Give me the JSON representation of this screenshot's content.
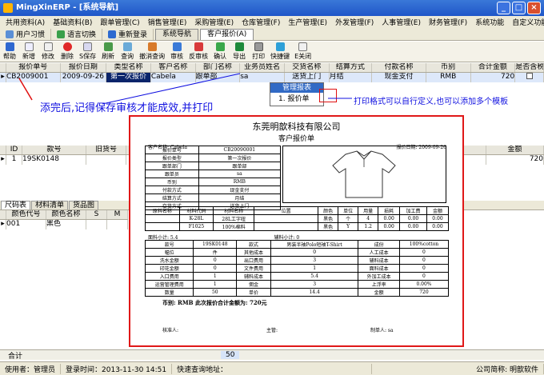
{
  "window": {
    "title": "MingXinERP - [系统导航]",
    "min": "_",
    "max": "□",
    "close": "×"
  },
  "menu": [
    "共用资料(A)",
    "基础资料(B)",
    "跟单管理(C)",
    "销售管理(E)",
    "采购管理(E)",
    "仓库管理(F)",
    "生产管理(E)",
    "外发管理(F)",
    "人事管理(E)",
    "财务管理(F)",
    "系统功能",
    "自定义功能"
  ],
  "quickbar": {
    "user_habits": "用户习惯",
    "language": "语言切换",
    "relogin": "重新登录",
    "tabs": [
      "系统导航",
      "客户报价(A)"
    ]
  },
  "toolbar": [
    "帮助",
    "新增",
    "修改",
    "删除",
    "S保存",
    "刷新",
    "查询",
    "撤消查询",
    "审核",
    "反审核",
    "确认",
    "导出",
    "打印",
    "快捷键",
    "E关闭"
  ],
  "grid": {
    "headers": [
      "报价单号",
      "报价日期",
      "类型名称",
      "客户名称",
      "部门名称",
      "业务员姓名",
      "交货名称",
      "结算方式",
      "付款名称",
      "币别",
      "合计金额",
      "是否含税"
    ],
    "row": [
      "CB2009001",
      "2009-09-26",
      "第一次报价",
      "Cabela",
      "跟单部",
      "sa",
      "送货上门",
      "月结",
      "现金支付",
      "RMB",
      "720",
      ""
    ]
  },
  "popup": {
    "header": "管理报表",
    "item": "1. 报价单"
  },
  "annotations": {
    "left": "添完后,记得保存审核才能成效,并打印",
    "right": "打印格式可以自行定义,也可以添加多个模板"
  },
  "detail_grid": {
    "headers": [
      "ID",
      "款号",
      "旧货号",
      "述",
      "金额"
    ],
    "row": [
      "1",
      "19SK0148",
      "",
      "",
      "720"
    ]
  },
  "bottom_tabs": [
    "尺码表",
    "材料清单",
    "货品图"
  ],
  "size_grid": {
    "headers": [
      "颜色代号",
      "颜色名称",
      "S",
      "M"
    ],
    "row": [
      "001",
      "黑色",
      "",
      ""
    ]
  },
  "summary": {
    "label": "合计",
    "value": "50"
  },
  "status": {
    "user": "使用者：管理员",
    "login": "登录时间：2013-11-30 14:51",
    "query": "快速查询地址：",
    "company": "公司简称: 明歆软件"
  },
  "preview": {
    "company": "东莞明歆科技有限公司",
    "doc_title": "客户报价单",
    "customer": "客户名称: Cabela",
    "date": "报价日期: 2009-09-26",
    "info": [
      [
        "报价单号",
        "CB20090001"
      ],
      [
        "报价类型",
        "第一次报价"
      ],
      [
        "跟单部门",
        "跟单部"
      ],
      [
        "跟单员",
        "sa"
      ],
      [
        "币别",
        "RMB"
      ],
      [
        "付款方式",
        "现金支付"
      ],
      [
        "结算方式",
        "月结"
      ],
      [
        "交货方式",
        "送货上门"
      ]
    ],
    "mat_headers": [
      "原料名称",
      "材料代码",
      "材料名称",
      "位置",
      "颜色",
      "单位",
      "用量",
      "损耗",
      "加工费",
      "金额"
    ],
    "mat_rows": [
      [
        "",
        "K-28L",
        "28L工字纽",
        "",
        "黑色",
        "个",
        "4",
        "0.00",
        "0.00",
        "0.00"
      ],
      [
        "",
        "F1025",
        "100%棉料",
        "",
        "黑色",
        "Y",
        "1.2",
        "0.00",
        "0.00",
        "0.00"
      ]
    ],
    "mat_total": "面料小计: 5.4",
    "aux_total": "辅料小计: 0",
    "cost_rows": [
      [
        "款号",
        "19SK0148",
        "款式",
        "男装半袖Polo短袖T-Shirt",
        "成份",
        "100%cotton"
      ],
      [
        "幅位",
        "件",
        "其他成本",
        "0",
        "人工成本",
        "0"
      ],
      [
        "洗水金额",
        "0",
        "出口费用",
        "3",
        "辅料成本",
        "0"
      ],
      [
        "印花金额",
        "0",
        "文件费用",
        "1",
        "面料成本",
        "0"
      ],
      [
        "入口费用",
        "1",
        "辅料成本",
        "5.4",
        "外加工成本",
        "0"
      ],
      [
        "运营管理费用",
        "1",
        "佣金",
        "3",
        "上浮率",
        "0.00%"
      ],
      [
        "数量",
        "50",
        "单价",
        "14.4",
        "金额",
        "720"
      ]
    ],
    "total_line": "币别: RMB   此次报价合计金额为: 720元",
    "signers": [
      "核准人:",
      "主管:",
      "制单人: sa"
    ]
  }
}
